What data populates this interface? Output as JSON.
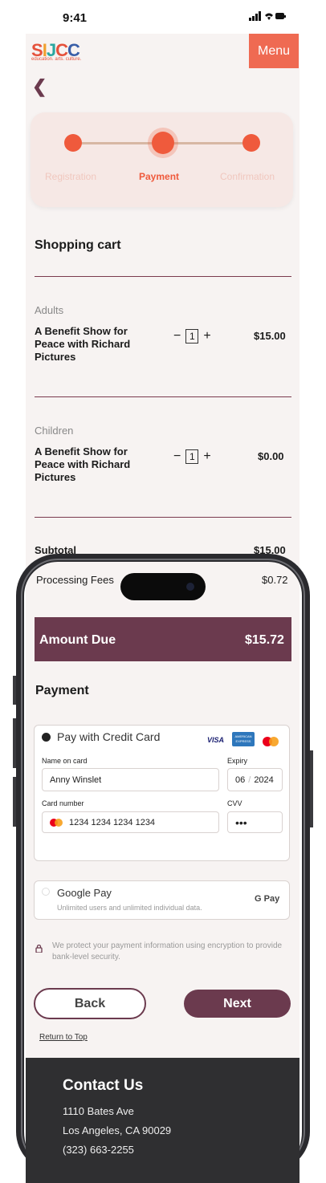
{
  "status_bar": {
    "time": "9:41",
    "icons": "signal-wifi-battery"
  },
  "header": {
    "logo": "SIJCC",
    "tagline": "education. arts. culture.",
    "menu_label": "Menu"
  },
  "stepper": {
    "steps": [
      "Registration",
      "Payment",
      "Confirmation"
    ],
    "active_index": 1
  },
  "cart": {
    "title": "Shopping cart",
    "items": [
      {
        "category": "Adults",
        "name": "A Benefit Show for Peace with Richard Pictures",
        "quantity": "1",
        "price": "$15.00"
      },
      {
        "category": "Children",
        "name": "A Benefit Show for Peace with Richard Pictures",
        "quantity": "1",
        "price": "$0.00"
      }
    ],
    "subtotal_label": "Subtotal",
    "subtotal_value": "$15.00",
    "fees_label": "Processing Fees",
    "fees_value": "$0.72",
    "amount_due_label": "Amount Due",
    "amount_due_value": "$15.72"
  },
  "payment": {
    "title": "Payment",
    "credit_card": {
      "label": "Pay with Credit Card",
      "name_label": "Name on card",
      "name_value": "Anny Winslet",
      "expiry_label": "Expiry",
      "expiry_month": "06",
      "expiry_year": "2024",
      "number_label": "Card number",
      "number_value": "1234 1234 1234 1234",
      "cvv_label": "CVV",
      "cvv_value": "•••",
      "brand_visa": "VISA",
      "brand_amex": "AMERICAN EXPRESS"
    },
    "google_pay": {
      "label": "Google Pay",
      "description": "Unlimited users and unlimited individual data.",
      "badge": "G Pay"
    },
    "security_note": "We protect your payment information using encryption to provide bank-level security."
  },
  "actions": {
    "back_label": "Back",
    "next_label": "Next",
    "return_top_label": "Return to Top"
  },
  "footer": {
    "title": "Contact Us",
    "address1": "1110 Bates Ave",
    "address2": "Los Angeles, CA 90029",
    "phone": "(323) 663-2255"
  },
  "colors": {
    "accent": "#ef5a3c",
    "brand": "#6b3a4e",
    "menu": "#ef6a52",
    "footer": "#2f2f31"
  }
}
